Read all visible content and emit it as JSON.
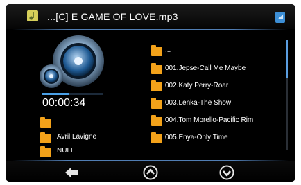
{
  "title": "...[C]  E  GAME OF LOVE.mp3",
  "title_icon": "music-note-card-icon",
  "settings_icon": "settings-card-icon",
  "playback": {
    "time": "00:00:34",
    "progress_fraction": 0.45
  },
  "info": {
    "artist": "Avril Lavigne",
    "album": "NULL"
  },
  "list": {
    "items": [
      {
        "label": "...",
        "icon": "folder-icon"
      },
      {
        "label": "001.Jepse-Call Me Maybe",
        "icon": "folder-icon"
      },
      {
        "label": "002.Katy Perry-Roar",
        "icon": "folder-icon"
      },
      {
        "label": "003.Lenka-The Show",
        "icon": "folder-icon"
      },
      {
        "label": "004.Tom Morello-Pacific Rim",
        "icon": "folder-icon"
      },
      {
        "label": "005.Enya-Only Time",
        "icon": "folder-icon"
      }
    ],
    "scroll_fraction": 0.35
  },
  "nav": {
    "back_icon": "back-arrow-icon",
    "up_icon": "chevron-up-circle-icon",
    "down_icon": "chevron-down-circle-icon"
  },
  "colors": {
    "accent": "#4aa0e6",
    "folder": "#f3a21a",
    "background": "#000000"
  }
}
